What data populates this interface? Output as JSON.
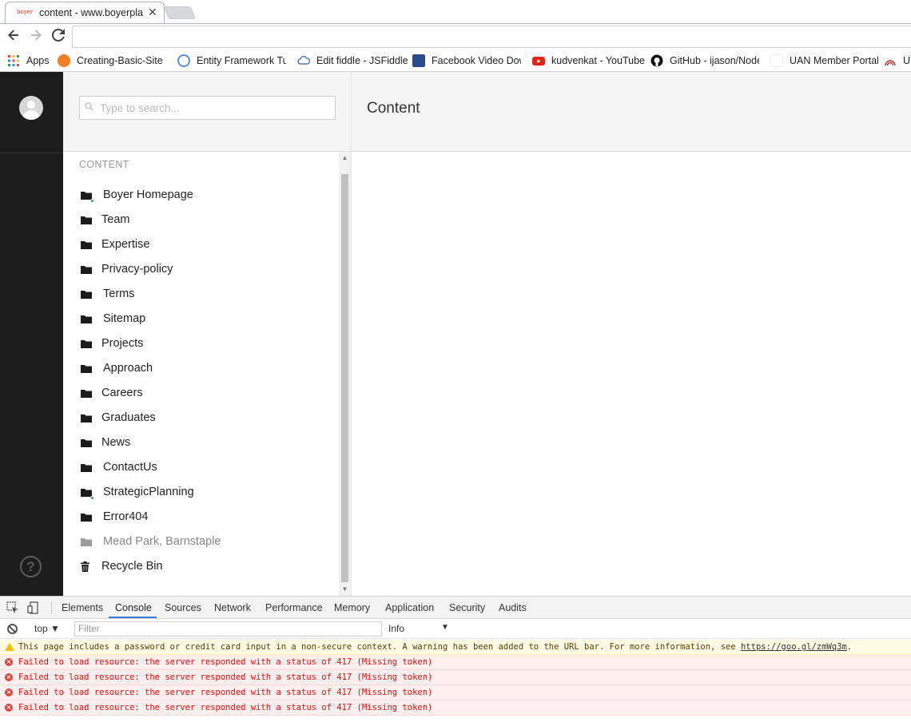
{
  "browser": {
    "tab": {
      "favicon_text": "boyer",
      "title": "content - www.boyerplan",
      "close": "✕"
    },
    "address": "",
    "bookmarks": [
      {
        "label": "Apps",
        "icon": "apps-grid-icon",
        "color": "#e8453c"
      },
      {
        "label": "Creating-Basic-Site -",
        "icon": "orange-heart-icon",
        "color": "#f47f24"
      },
      {
        "label": "Entity Framework Tut",
        "icon": "entity-framework-icon",
        "color": "#5b8dd6"
      },
      {
        "label": "Edit fiddle - JSFiddle",
        "icon": "jsfiddle-cloud-icon",
        "color": "#4679bd"
      },
      {
        "label": "Facebook Video Dow",
        "icon": "fbdown-icon",
        "color": "#2a4b8d"
      },
      {
        "label": "kudvenkat - YouTube",
        "icon": "youtube-icon",
        "color": "#e62117"
      },
      {
        "label": "GitHub - ijason/Node",
        "icon": "github-icon",
        "color": "#111111"
      },
      {
        "label": "UAN Member Portal",
        "icon": "blank-page-icon",
        "color": "#ffffff"
      },
      {
        "label": "U",
        "icon": "emblem-icon",
        "color": "#c0392b"
      }
    ]
  },
  "app": {
    "search": {
      "placeholder": "Type to search..."
    },
    "section_title": "CONTENT",
    "main_title": "Content",
    "help_glyph": "?",
    "tree": [
      {
        "label": "Boyer Homepage",
        "published": true,
        "muted": false,
        "icon": "folder-icon"
      },
      {
        "label": "Team",
        "published": false,
        "muted": false,
        "icon": "folder-icon"
      },
      {
        "label": "Expertise",
        "published": false,
        "muted": false,
        "icon": "folder-icon"
      },
      {
        "label": "Privacy-policy",
        "published": false,
        "muted": false,
        "icon": "folder-icon"
      },
      {
        "label": "Terms",
        "published": false,
        "muted": false,
        "icon": "folder-icon"
      },
      {
        "label": "Sitemap",
        "published": false,
        "muted": false,
        "icon": "folder-icon"
      },
      {
        "label": "Projects",
        "published": false,
        "muted": false,
        "icon": "folder-icon"
      },
      {
        "label": "Approach",
        "published": false,
        "muted": false,
        "icon": "folder-icon"
      },
      {
        "label": "Careers",
        "published": false,
        "muted": false,
        "icon": "folder-icon"
      },
      {
        "label": "Graduates",
        "published": false,
        "muted": false,
        "icon": "folder-icon"
      },
      {
        "label": "News",
        "published": false,
        "muted": false,
        "icon": "folder-icon"
      },
      {
        "label": "ContactUs",
        "published": false,
        "muted": false,
        "icon": "folder-icon"
      },
      {
        "label": "StrategicPlanning",
        "published": true,
        "muted": false,
        "icon": "folder-icon"
      },
      {
        "label": "Error404",
        "published": false,
        "muted": false,
        "icon": "folder-icon"
      },
      {
        "label": "Mead Park, Barnstaple",
        "published": false,
        "muted": true,
        "icon": "folder-icon"
      },
      {
        "label": "Recycle Bin",
        "published": false,
        "muted": false,
        "icon": "trash-icon"
      }
    ]
  },
  "devtools": {
    "tabs": [
      "Elements",
      "Console",
      "Sources",
      "Network",
      "Performance",
      "Memory",
      "Application",
      "Security",
      "Audits"
    ],
    "active_tab": "Console",
    "context": "top",
    "filter_placeholder": "Filter",
    "level": "Info",
    "messages": [
      {
        "type": "warning",
        "text": "This page includes a password or credit card input in a non-secure context. A warning has been added to the URL bar. For more information, see ",
        "link": "https://goo.gl/zmWq3m",
        "suffix": "."
      },
      {
        "type": "error",
        "text": "Failed to load resource: the server responded with a status of 417 (Missing token)"
      },
      {
        "type": "error",
        "text": "Failed to load resource: the server responded with a status of 417 (Missing token)"
      },
      {
        "type": "error",
        "text": "Failed to load resource: the server responded with a status of 417 (Missing token)"
      },
      {
        "type": "error",
        "text": "Failed to load resource: the server responded with a status of 417 (Missing token)"
      }
    ]
  }
}
